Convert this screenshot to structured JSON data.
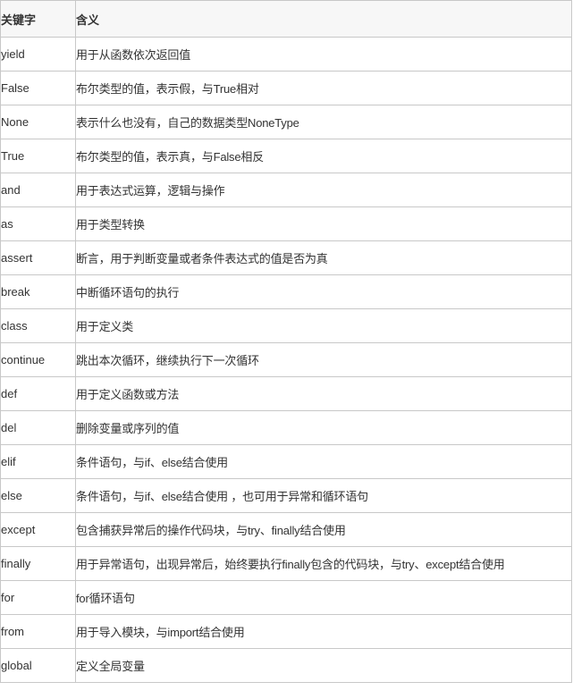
{
  "table": {
    "headers": {
      "keyword": "关键字",
      "meaning": "含义"
    },
    "rows": [
      {
        "keyword": "yield",
        "meaning": "用于从函数依次返回值"
      },
      {
        "keyword": "False",
        "meaning": "布尔类型的值，表示假，与True相对"
      },
      {
        "keyword": "None",
        "meaning": "表示什么也没有，自己的数据类型NoneType"
      },
      {
        "keyword": "True",
        "meaning": "布尔类型的值，表示真，与False相反"
      },
      {
        "keyword": "and",
        "meaning": "用于表达式运算，逻辑与操作"
      },
      {
        "keyword": "as",
        "meaning": "用于类型转换"
      },
      {
        "keyword": "assert",
        "meaning": "断言，用于判断变量或者条件表达式的值是否为真"
      },
      {
        "keyword": "break",
        "meaning": "中断循环语句的执行"
      },
      {
        "keyword": "class",
        "meaning": "用于定义类"
      },
      {
        "keyword": "continue",
        "meaning": "跳出本次循环，继续执行下一次循环"
      },
      {
        "keyword": "def",
        "meaning": "用于定义函数或方法"
      },
      {
        "keyword": "del",
        "meaning": "删除变量或序列的值"
      },
      {
        "keyword": "elif",
        "meaning": "条件语句，与if、else结合使用"
      },
      {
        "keyword": "else",
        "meaning": "条件语句，与if、else结合使用 ，也可用于异常和循环语句"
      },
      {
        "keyword": "except",
        "meaning": "包含捕获异常后的操作代码块，与try、finally结合使用"
      },
      {
        "keyword": "finally",
        "meaning": "用于异常语句，出现异常后，始终要执行finally包含的代码块，与try、except结合使用"
      },
      {
        "keyword": "for",
        "meaning": "for循环语句"
      },
      {
        "keyword": "from",
        "meaning": "用于导入模块，与import结合使用"
      },
      {
        "keyword": "global",
        "meaning": "定义全局变量"
      }
    ]
  }
}
